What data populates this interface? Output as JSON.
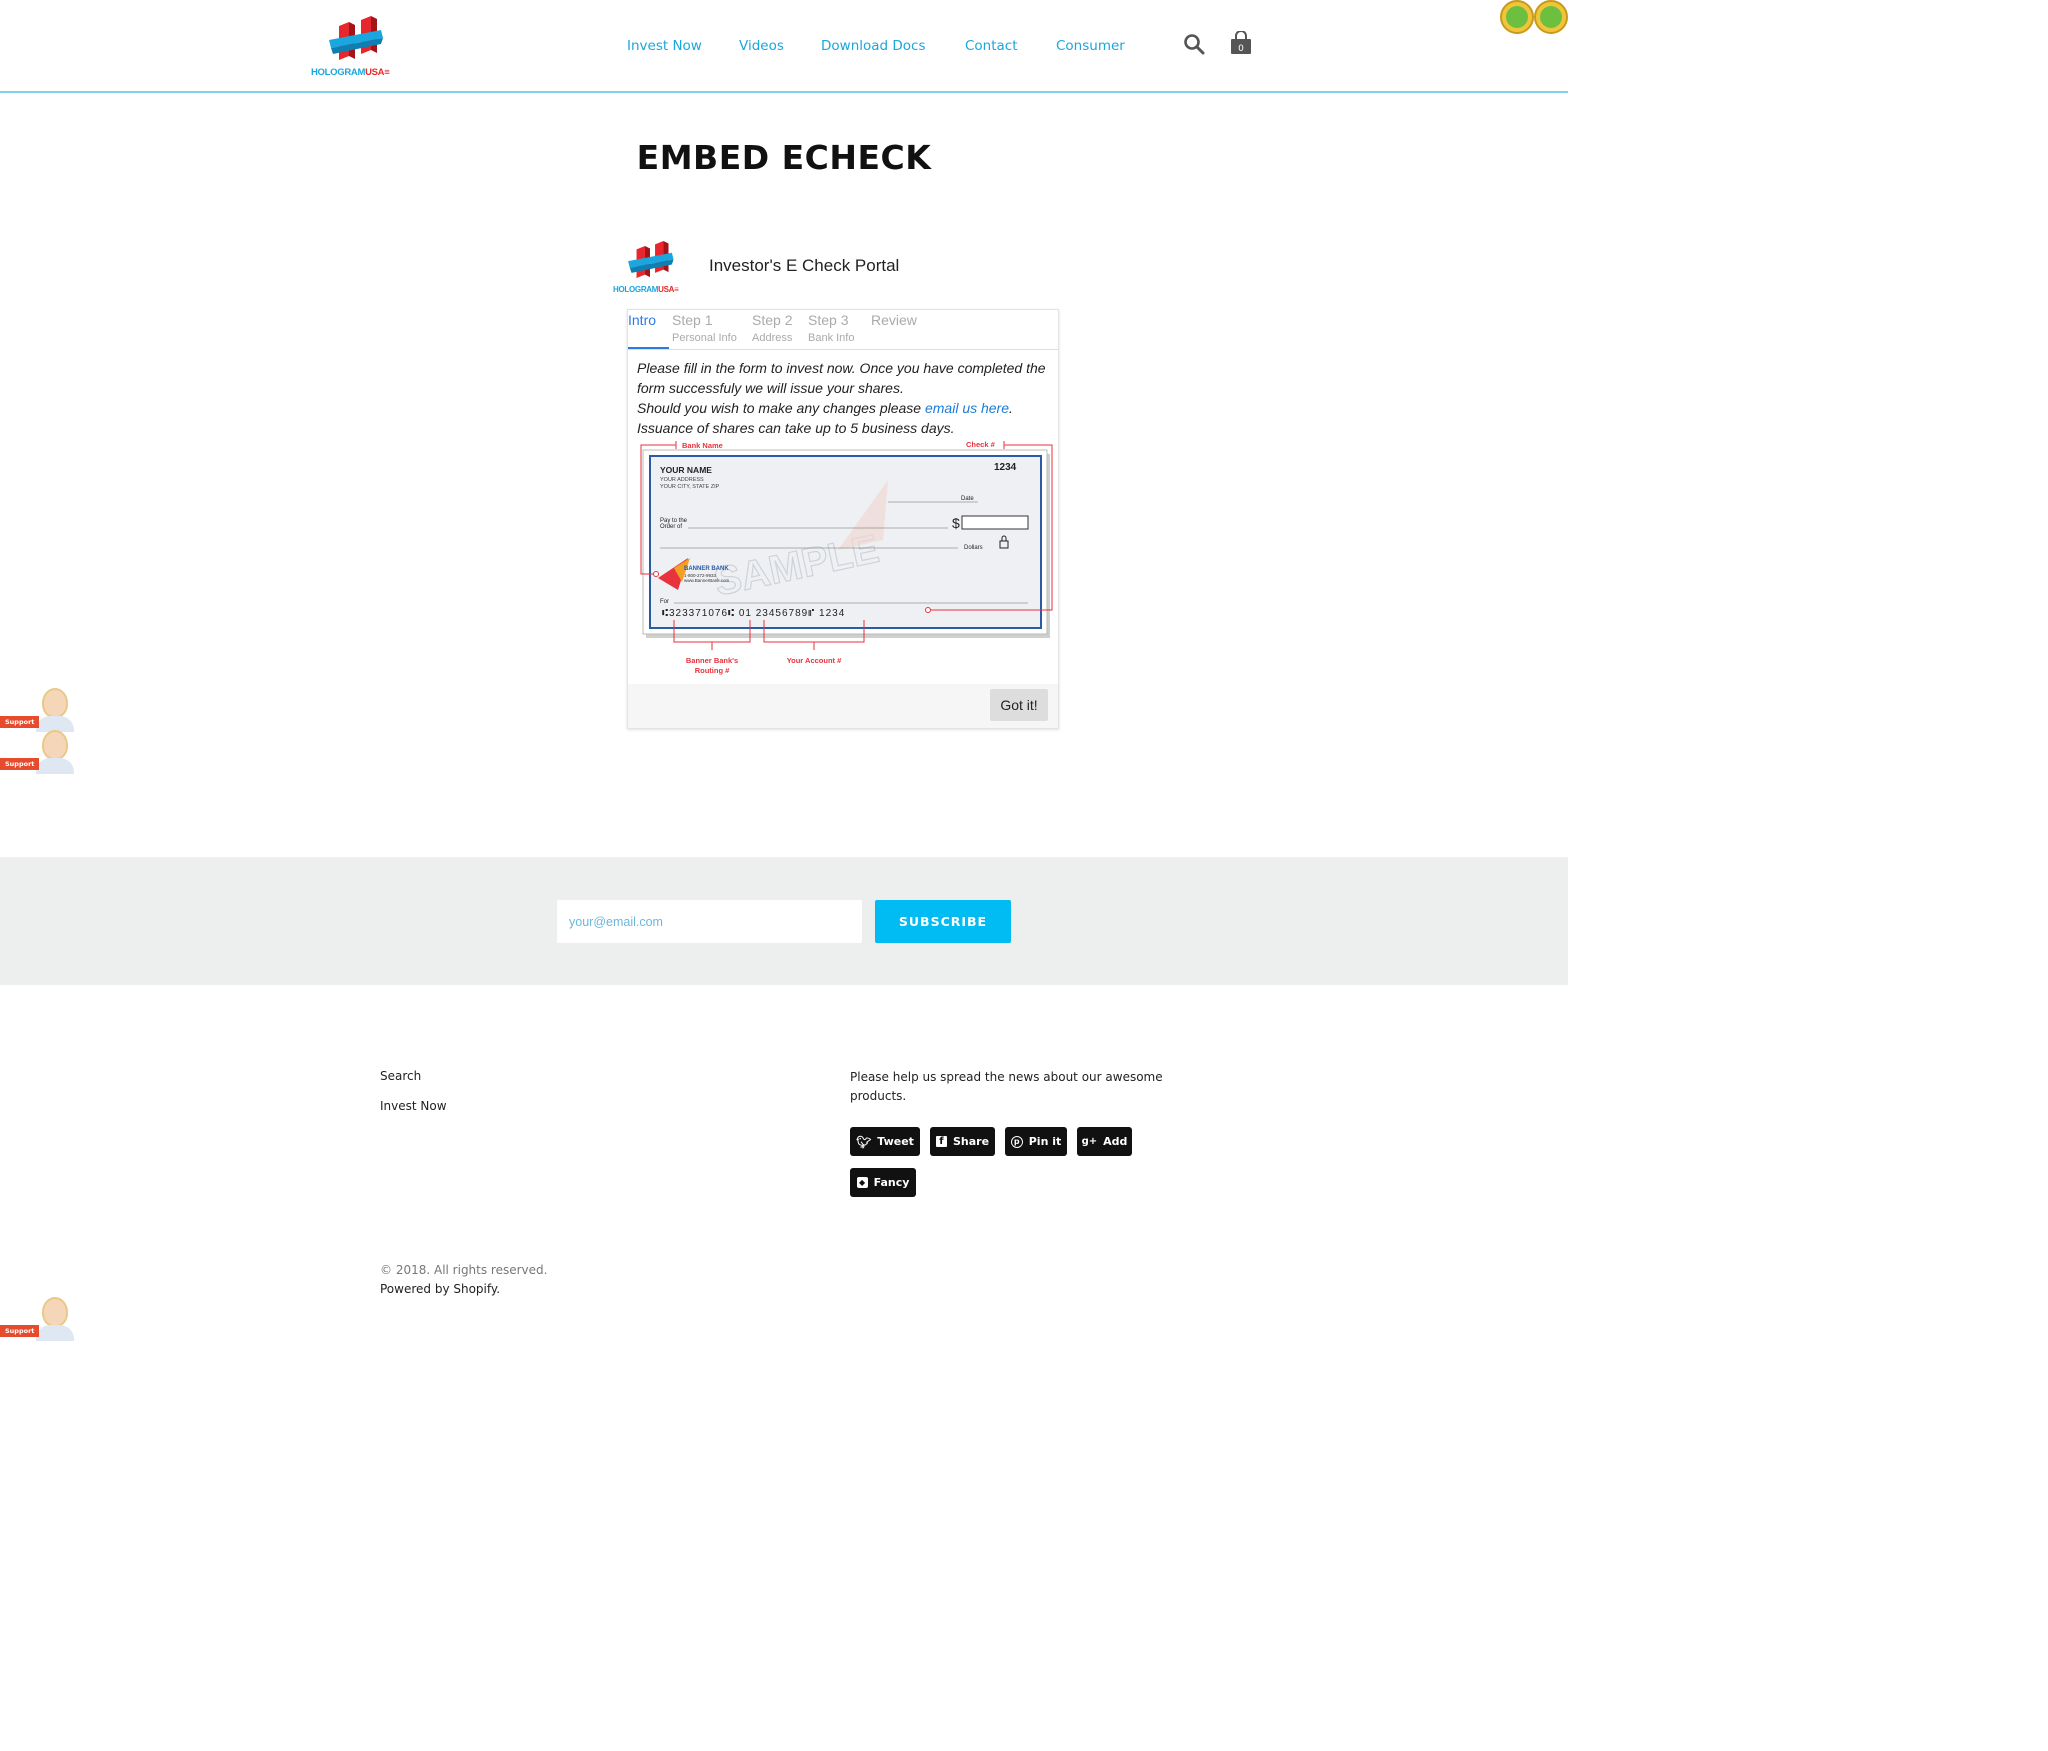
{
  "header": {
    "logo_text": "HOLOGRAM",
    "logo_text_accent": "USA",
    "nav": [
      {
        "label": "Invest Now"
      },
      {
        "label": "Videos"
      },
      {
        "label": "Download Docs"
      },
      {
        "label": "Contact"
      },
      {
        "label": "Consumer"
      }
    ],
    "cart_count": "0",
    "icons": [
      "search-icon",
      "shopping-bag-icon",
      "verified-badge-icon"
    ],
    "accent_color": "#1aa6de"
  },
  "page": {
    "title": "EMBED ECHECK"
  },
  "portal": {
    "heading": "Investor's E Check Portal",
    "tabs": [
      {
        "label": "Intro",
        "sub": ""
      },
      {
        "label": "Step 1",
        "sub": "Personal Info"
      },
      {
        "label": "Step 2",
        "sub": "Address"
      },
      {
        "label": "Step 3",
        "sub": "Bank Info"
      },
      {
        "label": "Review",
        "sub": ""
      }
    ],
    "active_tab": "Intro",
    "intro_line1": "Please fill in the form to invest now. Once you have completed the form successfuly we will issue your shares.",
    "intro_line2_pre": "Should you wish to make any changes please ",
    "intro_link": "email us here",
    "intro_line2_post": ".",
    "intro_line3": "Issuance of shares can take up to 5 business days.",
    "got_it": "Got it!",
    "check": {
      "label_bank_name": "Bank Name",
      "label_check_num": "Check #",
      "label_routing_1": "Banner Bank's",
      "label_routing_2": "Routing #",
      "label_account": "Your Account #",
      "your_name": "YOUR NAME",
      "your_address": "YOUR ADDRESS",
      "your_city": "YOUR CITY, STATE ZIP",
      "check_number": "1234",
      "date_label": "Date",
      "pay_to_1": "Pay to the",
      "pay_to_2": "Order of",
      "dollar_sign": "$",
      "dollars_label": "Dollars",
      "bank_name": "BANNER BANK",
      "bank_phone": "1-800-272-9933",
      "bank_web": "www.BannerBank.com",
      "for_label": "For",
      "micr_line": "⑆323371076⑆ 01 23456789⑈ 1234",
      "watermark": "SAMPLE",
      "accent_color": "#e8323c"
    }
  },
  "support_widget": {
    "label": "Support"
  },
  "subscribe": {
    "placeholder": "your@email.com",
    "button": "SUBSCRIBE",
    "button_color": "#00bcf2"
  },
  "footer": {
    "links": [
      "Search",
      "Invest Now"
    ],
    "spread_text": "Please help us spread the news about our awesome products.",
    "share_buttons": [
      {
        "label": "Tweet",
        "icon": "twitter-icon"
      },
      {
        "label": "Share",
        "icon": "facebook-icon"
      },
      {
        "label": "Pin it",
        "icon": "pinterest-icon"
      },
      {
        "label": "Add",
        "icon": "google-plus-icon"
      },
      {
        "label": "Fancy",
        "icon": "fancy-icon"
      }
    ],
    "copyright": "© 2018. All rights reserved.",
    "powered": "Powered by Shopify."
  }
}
